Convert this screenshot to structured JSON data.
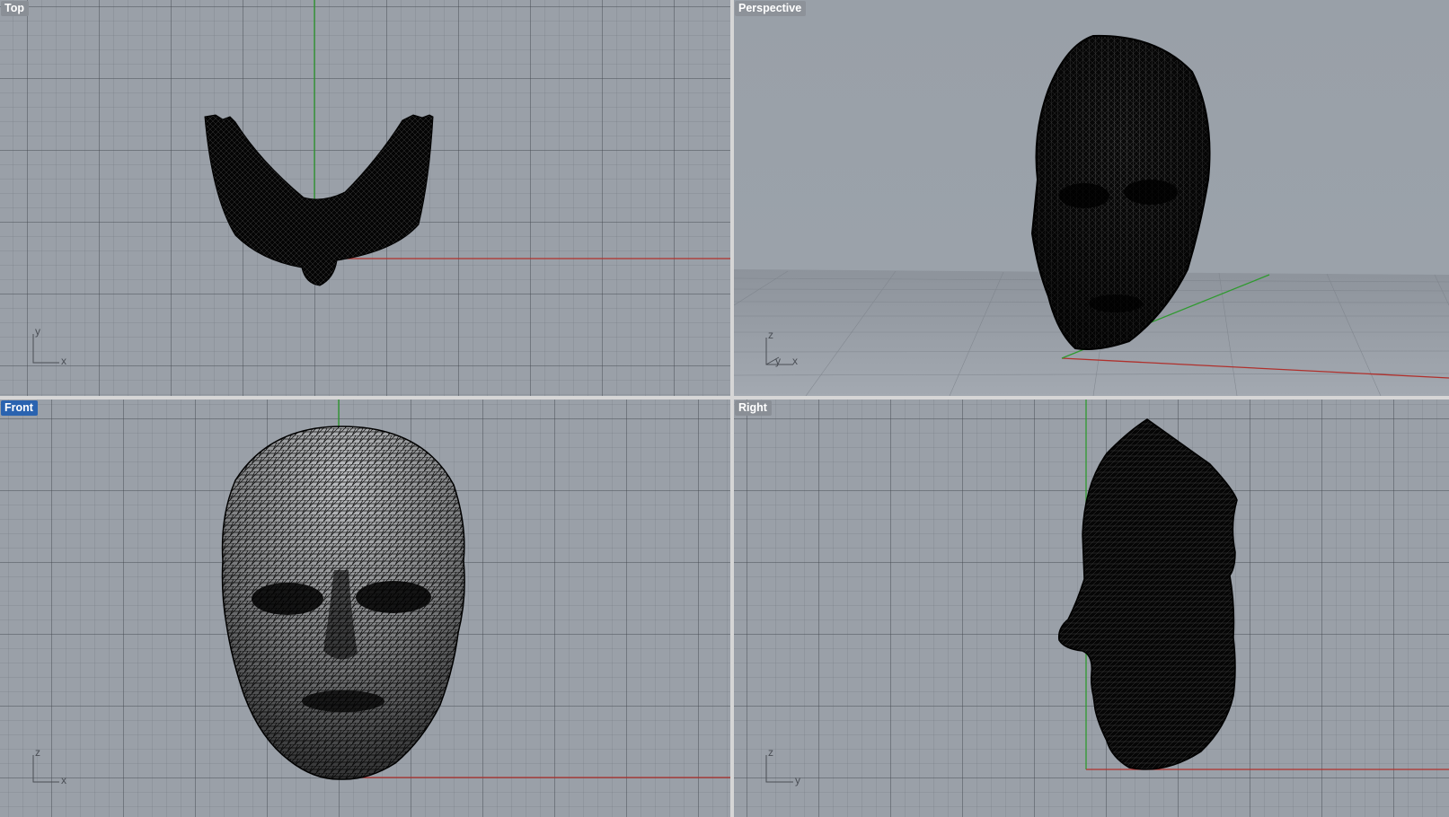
{
  "viewports": {
    "top": {
      "title": "Top",
      "axis_h": "x",
      "axis_v": "y"
    },
    "persp": {
      "title": "Perspective",
      "axis_h": "x",
      "axis_v": "z",
      "axis_d": "y"
    },
    "front": {
      "title": "Front",
      "axis_h": "x",
      "axis_v": "z",
      "active": true
    },
    "right": {
      "title": "Right",
      "axis_h": "y",
      "axis_v": "z"
    }
  },
  "colors": {
    "viewport_bg": "#9aa0a8",
    "x_axis": "#b0302c",
    "y_axis": "#2f9a2f",
    "mesh": "#000000",
    "active_title": "#2a63b0"
  }
}
